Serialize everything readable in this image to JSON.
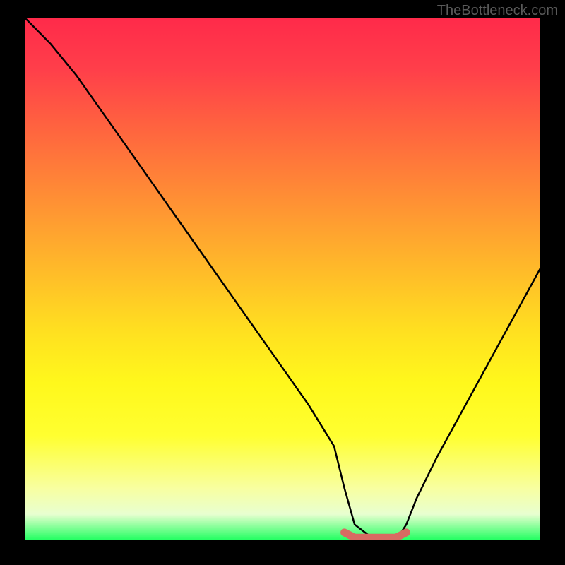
{
  "watermark": "TheBottleneck.com",
  "chart_data": {
    "type": "line",
    "title": "",
    "xlabel": "",
    "ylabel": "",
    "xlim": [
      0,
      100
    ],
    "ylim": [
      0,
      100
    ],
    "series": [
      {
        "name": "curve",
        "x": [
          0,
          5,
          10,
          15,
          20,
          25,
          30,
          35,
          40,
          45,
          50,
          55,
          60,
          62,
          64,
          68,
          72,
          74,
          76,
          80,
          85,
          90,
          95,
          100
        ],
        "values": [
          100,
          95,
          89,
          82,
          75,
          68,
          61,
          54,
          47,
          40,
          33,
          26,
          18,
          10,
          3,
          0,
          0,
          3,
          8,
          16,
          25,
          34,
          43,
          52
        ]
      },
      {
        "name": "highlight",
        "x": [
          62,
          64,
          66,
          68,
          70,
          72,
          74
        ],
        "values": [
          1.5,
          0.5,
          0.5,
          0.5,
          0.5,
          0.5,
          1.5
        ]
      }
    ],
    "gradient_stops": [
      {
        "pos": 0,
        "color": "#ff2a4a"
      },
      {
        "pos": 50,
        "color": "#ffc028"
      },
      {
        "pos": 80,
        "color": "#ffff30"
      },
      {
        "pos": 100,
        "color": "#20ff60"
      }
    ]
  }
}
